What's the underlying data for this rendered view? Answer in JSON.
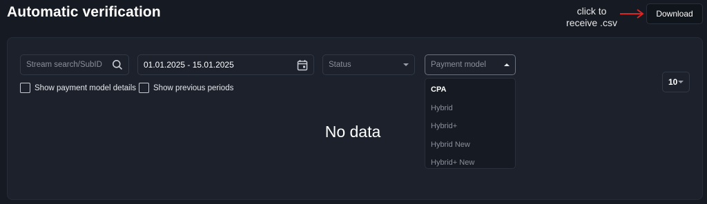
{
  "page": {
    "title": "Automatic verification"
  },
  "annotation": {
    "line1": "click to",
    "line2": "receive .csv"
  },
  "toolbar": {
    "download_label": "Download"
  },
  "filters": {
    "search_placeholder": "Stream search/SubID",
    "date_range": "01.01.2025 - 15.01.2025",
    "status_placeholder": "Status",
    "payment_model_placeholder": "Payment model"
  },
  "options": {
    "show_payment_model_details": "Show payment model details",
    "show_previous_periods": "Show previous periods"
  },
  "payment_model_options": [
    "CPA",
    "Hybrid",
    "Hybrid+",
    "Hybrid New",
    "Hybrid+ New"
  ],
  "empty_state": "No data",
  "pagination": {
    "page_size": "10"
  },
  "colors": {
    "background": "#161a22",
    "panel": "#1c212b",
    "arrow": "#e02424"
  },
  "icons": [
    "search-icon",
    "calendar-icon",
    "chevron-down-icon",
    "chevron-up-icon",
    "arrow-right-icon"
  ]
}
